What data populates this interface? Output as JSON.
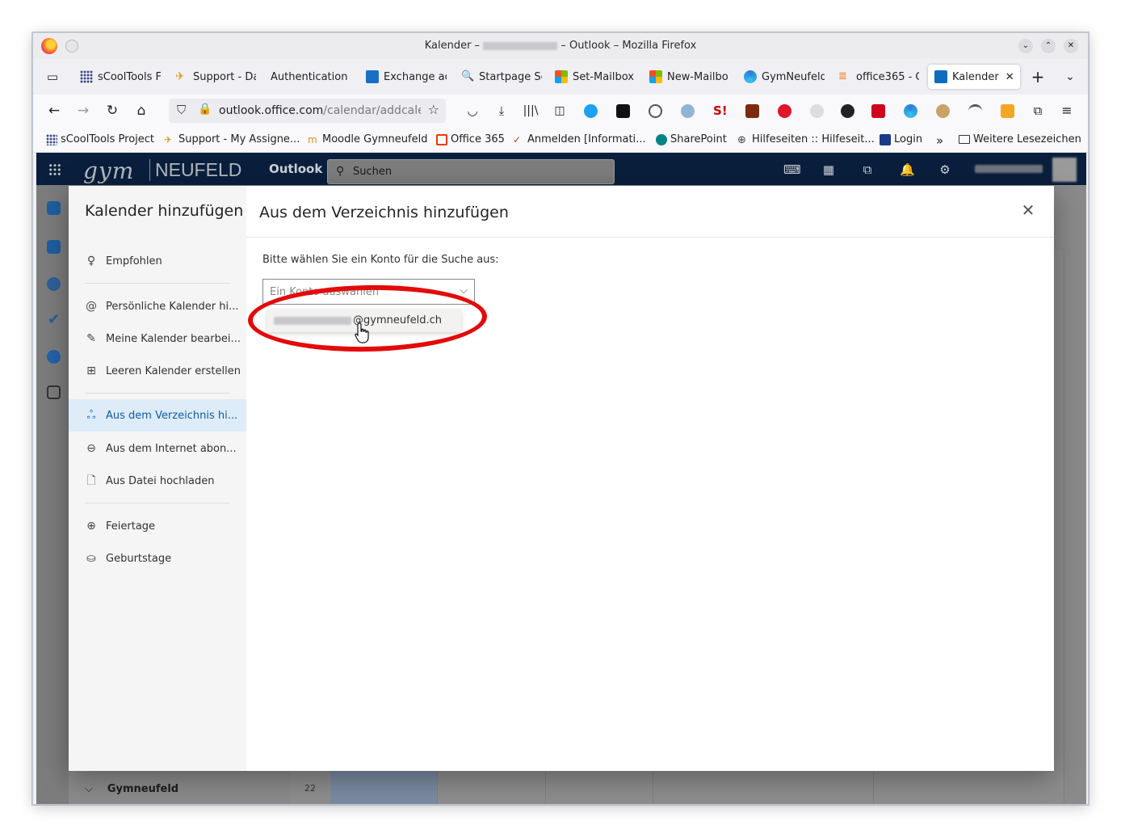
{
  "window": {
    "title_prefix": "Kalender –",
    "title_suffix": "– Outlook – Mozilla Firefox"
  },
  "tabs": [
    {
      "label": "sCoolTools F",
      "icon": "grid-icon",
      "color": "#3a4a8a"
    },
    {
      "label": "Support - Da",
      "icon": "support-icon",
      "color": "#e09a1a"
    },
    {
      "label": "Authentication",
      "icon": "",
      "color": ""
    },
    {
      "label": "Exchange ac",
      "icon": "exchange-icon",
      "color": "#1a6fc4"
    },
    {
      "label": "Startpage Se",
      "icon": "search-icon",
      "color": "#4a5fc1"
    },
    {
      "label": "Set-Mailbox",
      "icon": "microsoft-icon",
      "color": "#f25022"
    },
    {
      "label": "New-Mailbo",
      "icon": "microsoft-icon",
      "color": "#f25022"
    },
    {
      "label": "GymNeufeld",
      "icon": "edge-icon",
      "color": "#2a7fd4"
    },
    {
      "label": "office365 - C",
      "icon": "stackoverflow-icon",
      "color": "#f48024"
    },
    {
      "label": "Kalender",
      "icon": "calendar-icon",
      "color": "#0f6cbd",
      "active": true
    }
  ],
  "nav": {
    "url_host": "outlook.office.com",
    "url_path": "/calendar/addcalendar"
  },
  "bookmarks": [
    {
      "label": "sCoolTools Project",
      "color": "#3a4a8a"
    },
    {
      "label": "Support - My Assigne...",
      "color": "#e09a1a"
    },
    {
      "label": "Moodle Gymneufeld",
      "color": "#f18a1c"
    },
    {
      "label": "Office 365",
      "color": "#eb3c00"
    },
    {
      "label": "Anmelden [Informati...",
      "color": "#c0392b"
    },
    {
      "label": "SharePoint",
      "color": "#038387"
    },
    {
      "label": "Hilfeseiten :: Hilfeseit...",
      "color": "#444444"
    },
    {
      "label": "Login",
      "color": "#1a3a8a"
    },
    {
      "label": "»",
      "color": ""
    },
    {
      "label": "Weitere Lesezeichen",
      "color": ""
    }
  ],
  "owa": {
    "logo_gym": "gym",
    "logo_neufeld": "NEUFELD",
    "app_name": "Outlook",
    "search_placeholder": "Suchen",
    "group_label": "Gymneufeld",
    "day_number": "22"
  },
  "dialog": {
    "left_title": "Kalender hinzufügen",
    "nav_items": [
      {
        "label": "Empfohlen",
        "icon": "lightbulb-icon"
      },
      {
        "label": "Persönliche Kalender hi...",
        "icon": "at-icon"
      },
      {
        "label": "Meine Kalender bearbei...",
        "icon": "edit-calendar-icon"
      },
      {
        "label": "Leeren Kalender erstellen",
        "icon": "add-calendar-icon"
      },
      {
        "label": "Aus dem Verzeichnis hi...",
        "icon": "people-icon",
        "active": true
      },
      {
        "label": "Aus dem Internet abon...",
        "icon": "link-icon"
      },
      {
        "label": "Aus Datei hochladen",
        "icon": "file-upload-icon"
      },
      {
        "label": "Feiertage",
        "icon": "globe-icon"
      },
      {
        "label": "Geburtstage",
        "icon": "cake-icon"
      }
    ],
    "right_title": "Aus dem Verzeichnis hinzufügen",
    "prompt": "Bitte wählen Sie ein Konto für die Suche aus:",
    "select_placeholder": "Ein Konto auswählen",
    "option_domain": "@gymneufeld.ch"
  },
  "colors": {
    "accent": "#0f6cbd",
    "highlight_ring": "#e30a0a",
    "header_bg": "#0a1f3d"
  }
}
